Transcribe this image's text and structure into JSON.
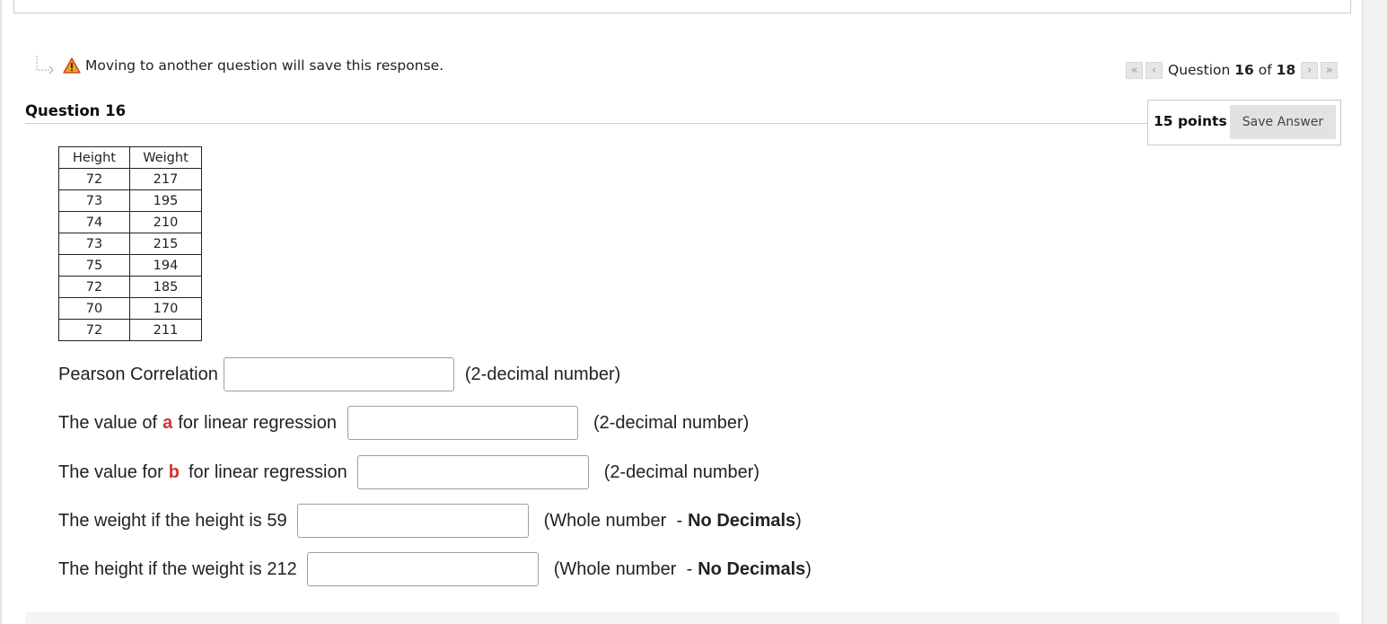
{
  "notice": {
    "warning_text": "Moving to another question will save this response.",
    "arrow_icon": "redirect-arrow-icon",
    "warning_icon": "warning-triangle-icon",
    "warning_color": "#f0a020"
  },
  "nav": {
    "prefix": "Question",
    "current": "16",
    "of": "of",
    "total": "18",
    "first_icon": "«",
    "prev_icon": "‹",
    "next_icon": "›",
    "last_icon": "»"
  },
  "question": {
    "title": "Question 16",
    "points": "15 points",
    "save_label": "Save Answer"
  },
  "table": {
    "headers": [
      "Height",
      "Weight"
    ],
    "rows": [
      [
        "72",
        "217"
      ],
      [
        "73",
        "195"
      ],
      [
        "74",
        "210"
      ],
      [
        "73",
        "215"
      ],
      [
        "75",
        "194"
      ],
      [
        "72",
        "185"
      ],
      [
        "70",
        "170"
      ],
      [
        "72",
        "211"
      ]
    ]
  },
  "fields": {
    "pearson": {
      "label": "Pearson Correlation",
      "hint": "(2-decimal number)",
      "value": ""
    },
    "a_value": {
      "label_pre": "The value of",
      "var": "a",
      "label_post": "for linear regression",
      "hint": "(2-decimal number)",
      "value": ""
    },
    "b_value": {
      "label_pre": "The value for",
      "var": "b",
      "label_post": "for linear regression",
      "hint": "(2-decimal number)",
      "value": ""
    },
    "weight59": {
      "label": "The weight if the height is 59",
      "hint_pre": "(Whole number  -",
      "hint_bold": "No Decimals",
      "hint_post": ")",
      "value": ""
    },
    "height212": {
      "label": "The height if the weight is 212",
      "hint_pre": "(Whole number  -",
      "hint_bold": "No Decimals",
      "hint_post": ")",
      "value": ""
    }
  },
  "colors": {
    "accent_red": "#d0342c",
    "button_bg": "#e2e2e2"
  }
}
